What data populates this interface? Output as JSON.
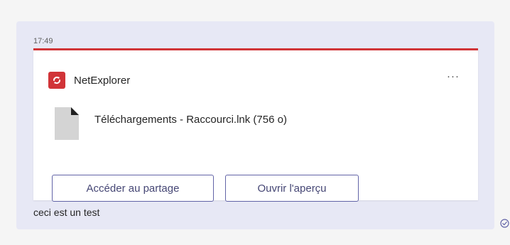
{
  "message": {
    "timestamp": "17:49",
    "text": "ceci est un test"
  },
  "card": {
    "accent_color": "#d13438",
    "app": {
      "name": "NetExplorer",
      "logo_icon": "netexplorer-logo-icon"
    },
    "more_icon": "more-options-icon",
    "more_label": "···",
    "file": {
      "icon": "file-icon",
      "name": "Téléchargements - Raccourci.lnk (756 o)"
    },
    "buttons": {
      "share_label": "Accéder au partage",
      "preview_label": "Ouvrir l'aperçu"
    }
  },
  "status": {
    "icon": "seen-check-icon"
  }
}
